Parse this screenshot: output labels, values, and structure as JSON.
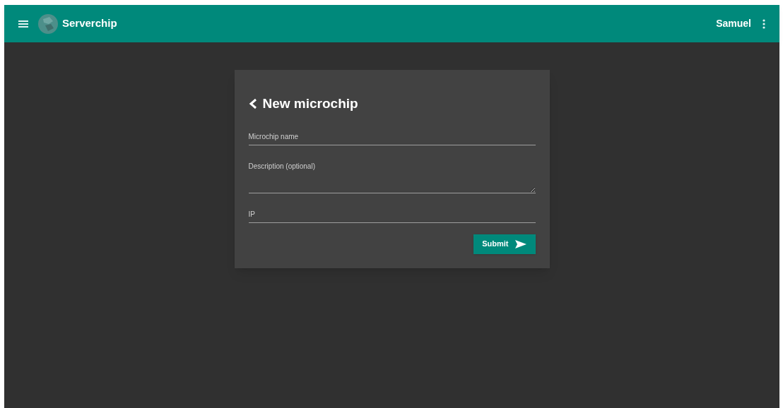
{
  "app_bar": {
    "title": "Serverchip",
    "user": "Samuel"
  },
  "form": {
    "title": "New microchip",
    "fields": [
      {
        "kind": "input",
        "placeholder": "Microchip name"
      },
      {
        "kind": "textarea",
        "placeholder": "Description (optional)"
      },
      {
        "kind": "input",
        "placeholder": "IP"
      }
    ],
    "submit": "Submit"
  }
}
